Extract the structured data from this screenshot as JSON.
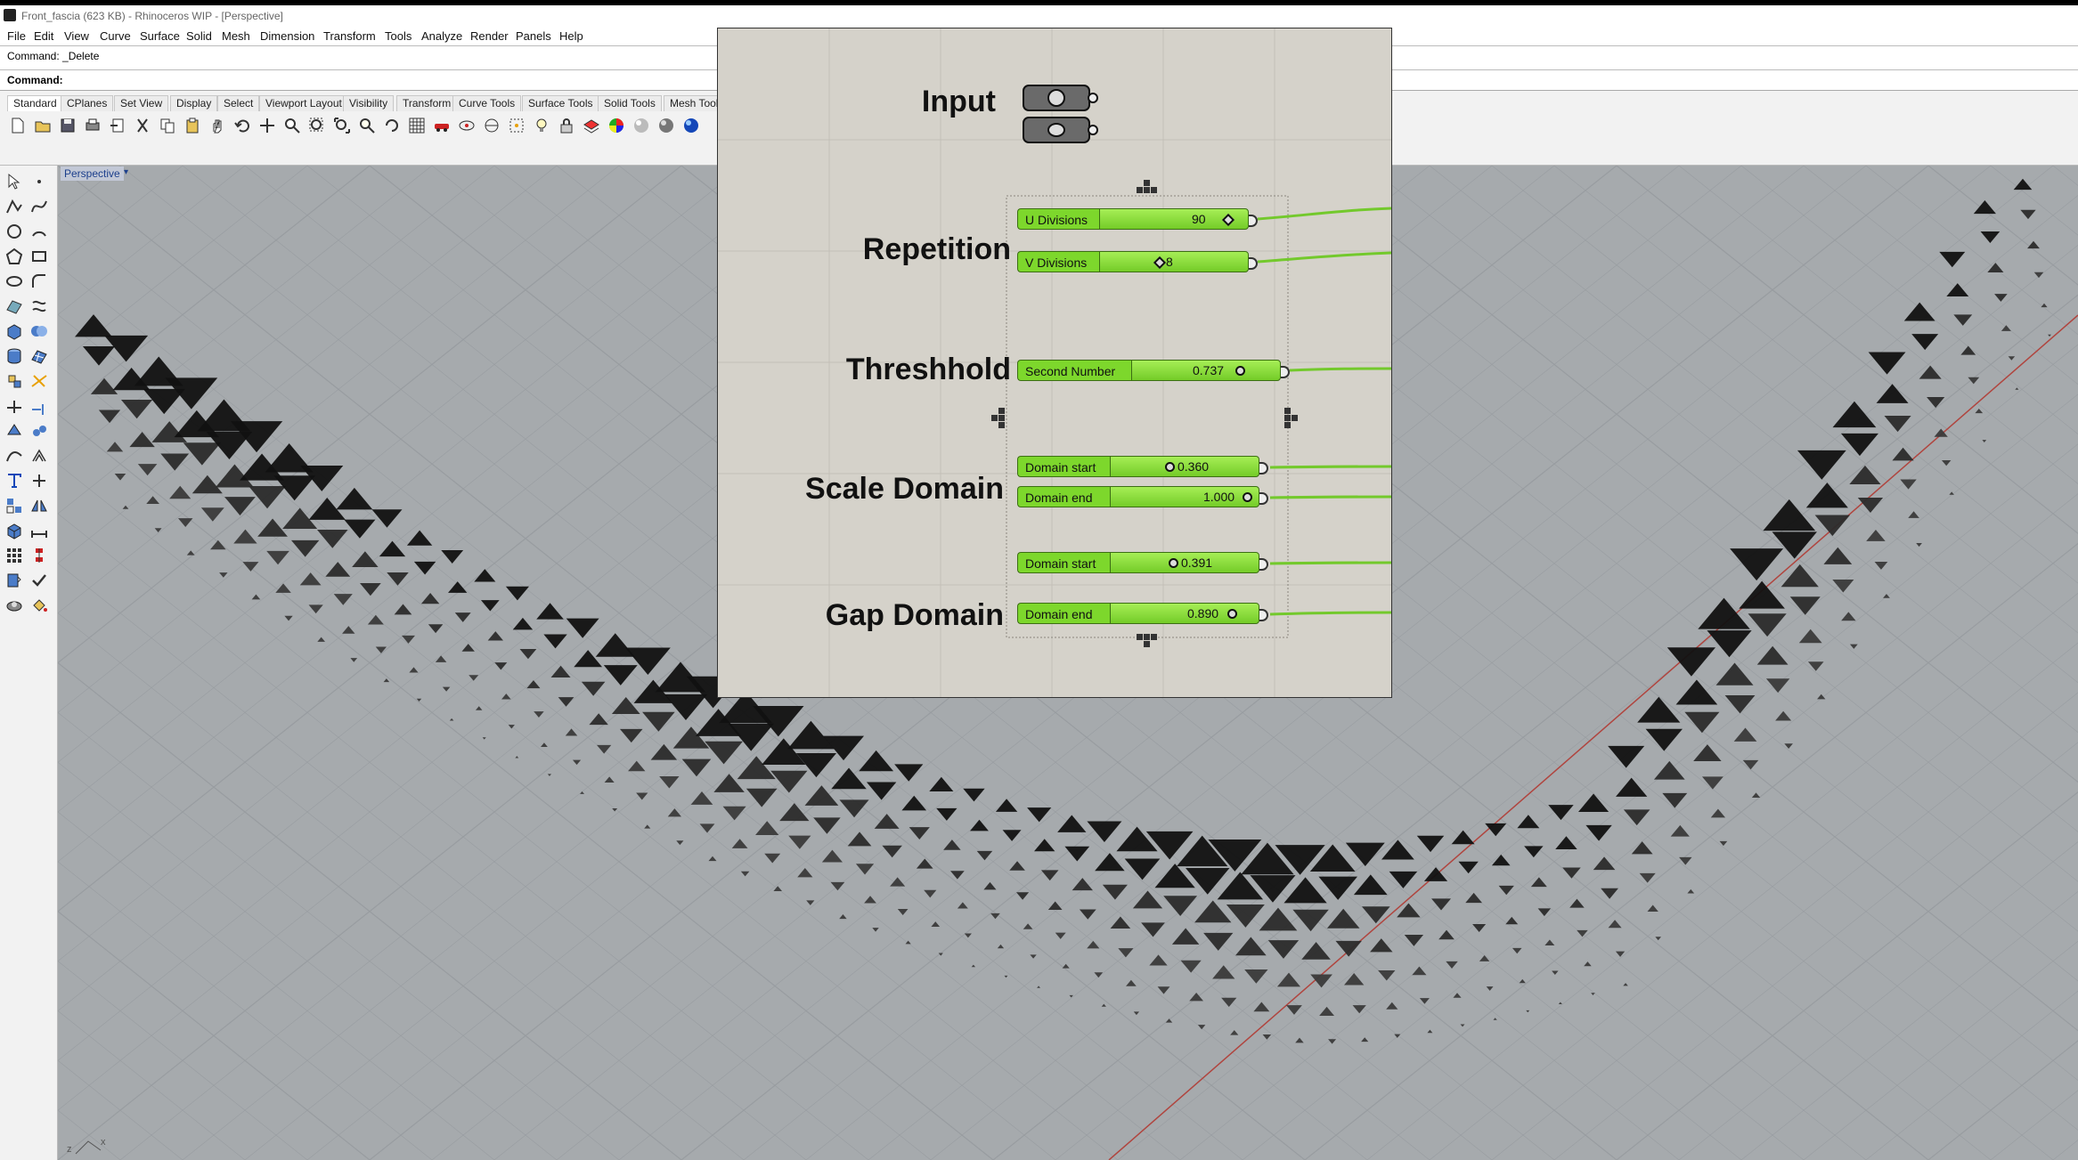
{
  "window": {
    "title": "Front_fascia (623 KB) - Rhinoceros WIP - [Perspective]"
  },
  "menu": [
    "File",
    "Edit",
    "View",
    "Curve",
    "Surface",
    "Solid",
    "Mesh",
    "Dimension",
    "Transform",
    "Tools",
    "Analyze",
    "Render",
    "Panels",
    "Help"
  ],
  "command": {
    "history": "Command: _Delete",
    "prompt": "Command:"
  },
  "tabs": [
    "Standard",
    "CPlanes",
    "Set View",
    "Display",
    "Select",
    "Viewport Layout",
    "Visibility",
    "Transform",
    "Curve Tools",
    "Surface Tools",
    "Solid Tools",
    "Mesh Tools"
  ],
  "active_tab": "Standard",
  "viewport": {
    "label": "Perspective"
  },
  "grasshopper": {
    "groups": {
      "input": "Input",
      "repetition": "Repetition",
      "threshold": "Threshhold",
      "scale_domain": "Scale Domain",
      "gap_domain": "Gap Domain"
    },
    "sliders": {
      "u_divisions": {
        "name": "U Divisions",
        "value": "90"
      },
      "v_divisions": {
        "name": "V Divisions",
        "value": "8"
      },
      "second_number": {
        "name": "Second Number",
        "value": "0.737"
      },
      "scale_start": {
        "name": "Domain start",
        "value": "0.360"
      },
      "scale_end": {
        "name": "Domain end",
        "value": "1.000"
      },
      "gap_start": {
        "name": "Domain start",
        "value": "0.391"
      },
      "gap_end": {
        "name": "Domain end",
        "value": "0.890"
      }
    }
  },
  "colors": {
    "slider_green": "#7dd72c",
    "wire_green": "#73c92c",
    "canvas": "#d5d2ca",
    "viewport": "#a6aaad",
    "x_axis": "#b0453f"
  }
}
